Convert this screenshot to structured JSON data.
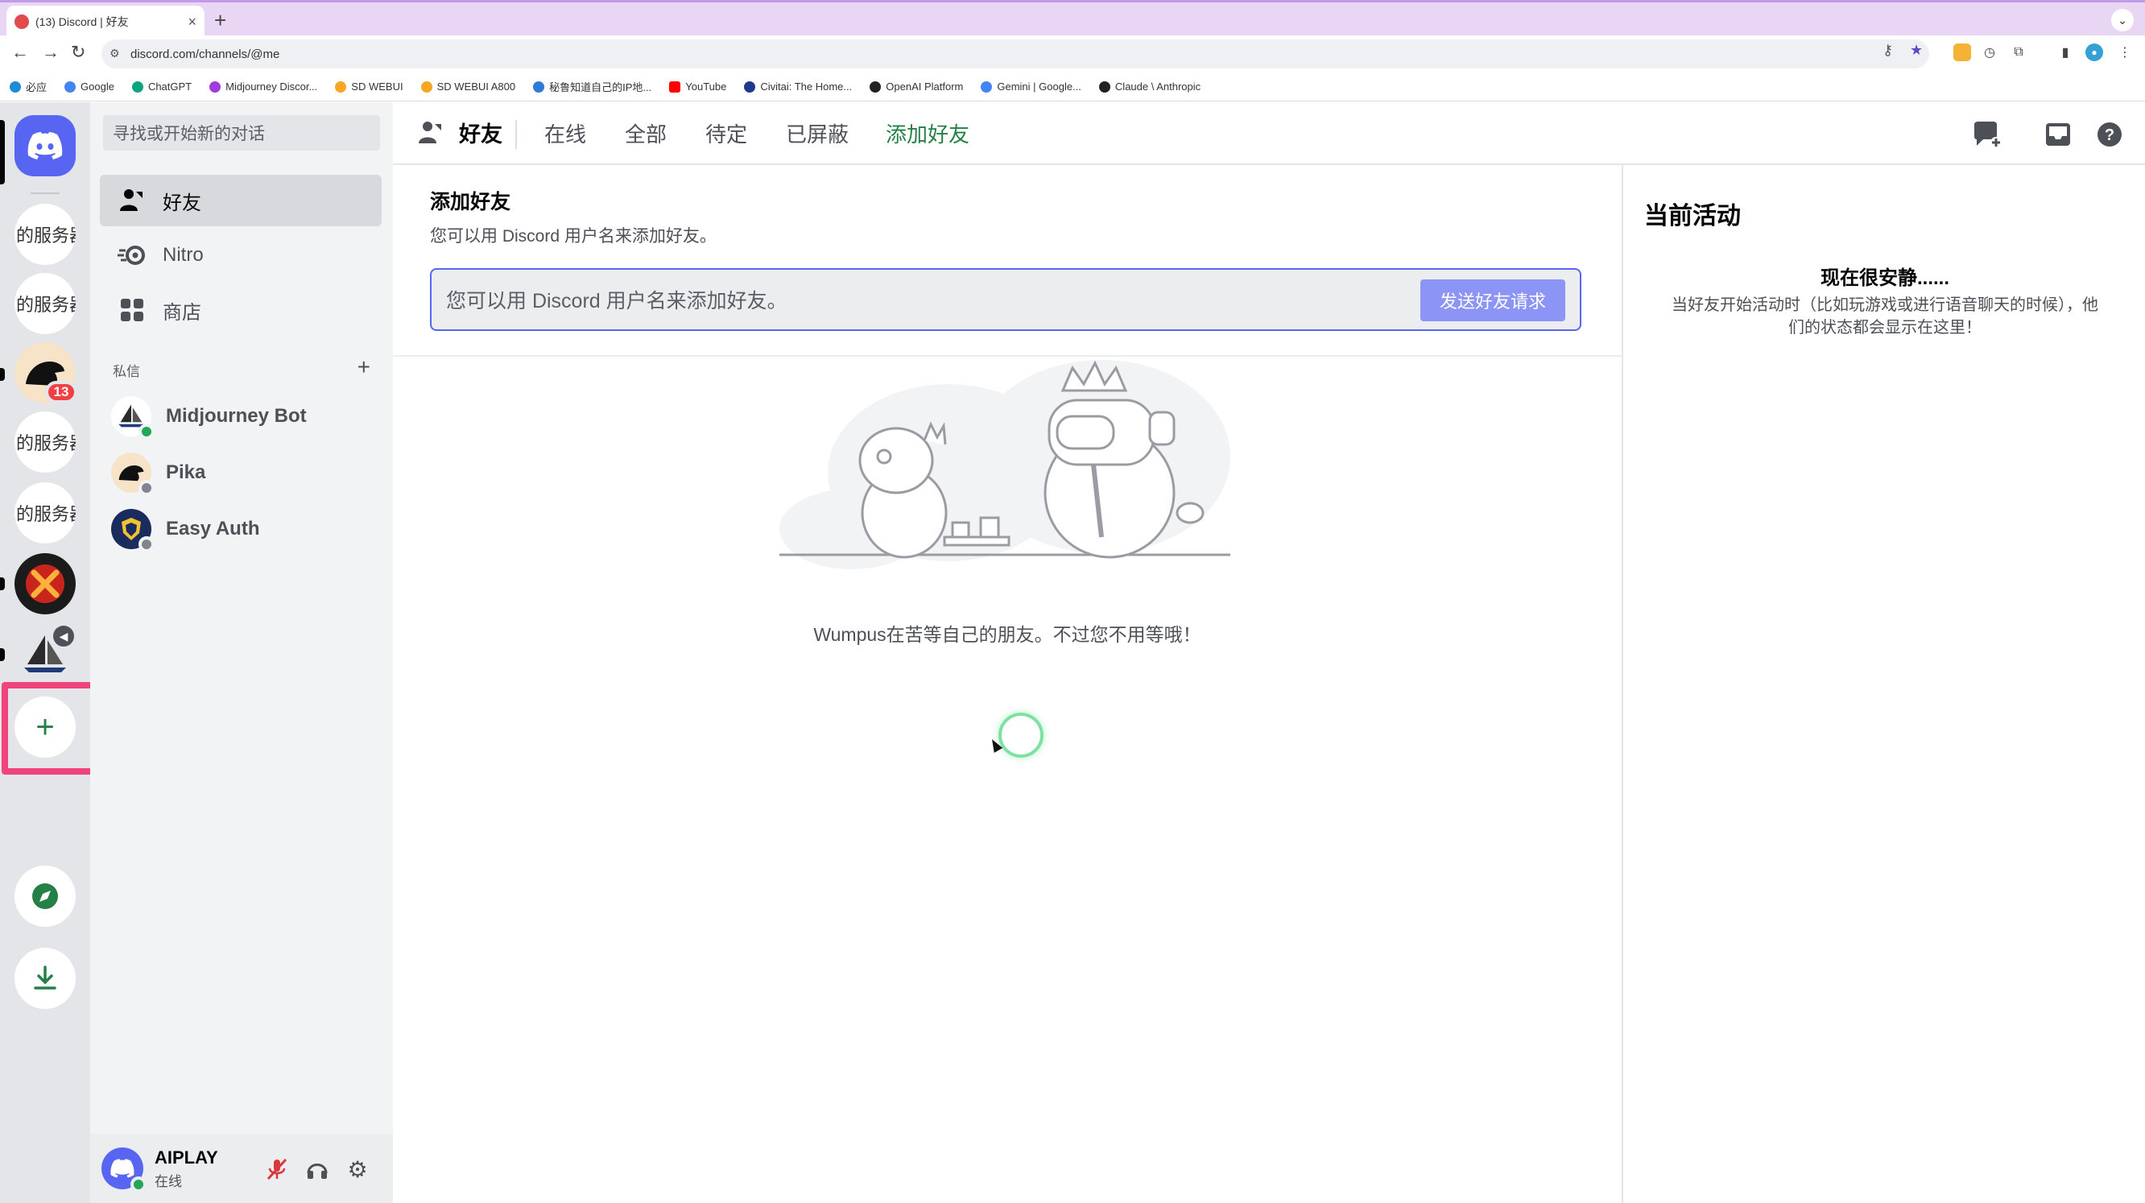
{
  "browser": {
    "tab_title": "(13) Discord | 好友",
    "new_tab": "+",
    "url": "discord.com/channels/@me",
    "bookmarks": [
      {
        "label": "必应",
        "color": "#1e8bd6"
      },
      {
        "label": "Google",
        "color": "#4285f4"
      },
      {
        "label": "ChatGPT",
        "color": "#10a37f"
      },
      {
        "label": "Midjourney Discor...",
        "color": "#a13bdc"
      },
      {
        "label": "SD WEBUI",
        "color": "#f5a623"
      },
      {
        "label": "SD WEBUI A800",
        "color": "#f5a623"
      },
      {
        "label": "秘鲁知道自己的IP地...",
        "color": "#2f7ad9"
      },
      {
        "label": "YouTube",
        "color": "#ff0000"
      },
      {
        "label": "Civitai: The Home...",
        "color": "#1e3a8a"
      },
      {
        "label": "OpenAI Platform",
        "color": "#222222"
      },
      {
        "label": "Gemini | Google...",
        "color": "#4285f4"
      },
      {
        "label": "Claude \\ Anthropic",
        "color": "#222222"
      }
    ]
  },
  "servers": [
    {
      "label": "的服务器"
    },
    {
      "label": "的服务器"
    },
    {
      "label": "",
      "badge": "13"
    },
    {
      "label": "的服务器"
    },
    {
      "label": "的服务器"
    }
  ],
  "dm": {
    "search_placeholder": "寻找或开始新的对话",
    "nav": [
      {
        "label": "好友",
        "icon": "friends-icon"
      },
      {
        "label": "Nitro",
        "icon": "nitro-icon"
      },
      {
        "label": "商店",
        "icon": "shop-icon"
      }
    ],
    "section_label": "私信",
    "add": "+",
    "users": [
      {
        "name": "Midjourney Bot",
        "status": "online"
      },
      {
        "name": "Pika",
        "status": "offline"
      },
      {
        "name": "Easy Auth",
        "status": "offline"
      }
    ]
  },
  "user_panel": {
    "name": "AIPLAY",
    "status": "在线"
  },
  "header": {
    "title": "好友",
    "tabs": [
      "在线",
      "全部",
      "待定",
      "已屏蔽"
    ],
    "add_friend": "添加好友"
  },
  "add_friend": {
    "title": "添加好友",
    "description": "您可以用 Discord 用户名来添加好友。",
    "input_placeholder": "您可以用 Discord 用户名来添加好友。",
    "button": "发送好友请求"
  },
  "empty_state": "Wumpus在苦等自己的朋友。不过您不用等哦！",
  "activity": {
    "title": "当前活动",
    "empty_title": "现在很安静......",
    "empty_desc": "当好友开始活动时（比如玩游戏或进行语音聊天的时候），他们的状态都会显示在这里！"
  },
  "colors": {
    "blurple": "#5865f2",
    "green": "#248046",
    "highlight": "#f0457c",
    "badge": "#f23f43"
  }
}
